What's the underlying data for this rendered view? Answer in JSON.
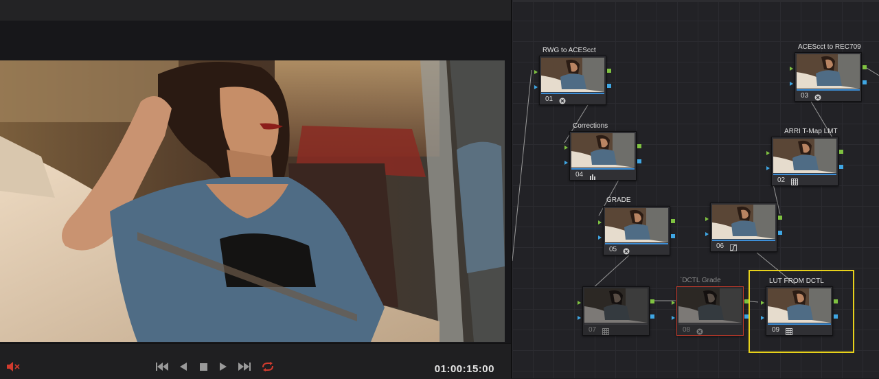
{
  "viewer": {
    "timecode": "01:00:15:00",
    "transport": {
      "mute_icon": "speaker-muted-icon",
      "buttons": [
        "skip-to-start-icon",
        "play-reverse-icon",
        "stop-icon",
        "play-icon",
        "skip-to-end-icon",
        "loop-icon"
      ]
    }
  },
  "node_editor": {
    "nodes": [
      {
        "id": "01",
        "number": "01",
        "label": "RWG to ACEScct",
        "icon": "color-space-icon",
        "disabled": false
      },
      {
        "id": "03",
        "number": "03",
        "label": "ACEScct to REC709",
        "icon": "color-space-icon",
        "disabled": false
      },
      {
        "id": "04",
        "number": "04",
        "label": "Corrections",
        "icon": "bars-icon",
        "disabled": false
      },
      {
        "id": "02",
        "number": "02",
        "label": "ARRI T-Map LMT",
        "icon": "lut-grid-icon",
        "disabled": false
      },
      {
        "id": "05",
        "number": "05",
        "label": "GRADE",
        "icon": "color-space-icon",
        "disabled": false
      },
      {
        "id": "06",
        "number": "06",
        "label": "",
        "icon": "curve-icon",
        "disabled": false
      },
      {
        "id": "07",
        "number": "07",
        "label": "",
        "icon": "lut-grid-icon",
        "disabled": true
      },
      {
        "id": "08",
        "number": "08",
        "label": "`DCTL Grade",
        "icon": "color-space-icon",
        "disabled": true
      },
      {
        "id": "09",
        "number": "09",
        "label": "LUT FROM DCTL",
        "icon": "lut-grid-icon",
        "disabled": false
      }
    ],
    "selected_node": "09",
    "colors": {
      "selection": "#e8d21b",
      "error_outline": "#c03a2b",
      "port_green": "#7fc241",
      "port_blue": "#3fa6e3"
    }
  }
}
